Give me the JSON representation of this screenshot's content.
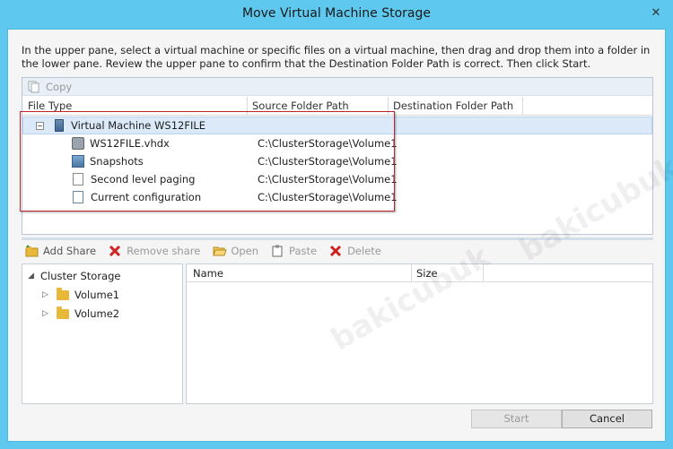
{
  "window": {
    "title": "Move Virtual Machine Storage",
    "close_glyph": "✕"
  },
  "intro_text": "In the upper pane, select a virtual machine or specific files on a virtual machine, then drag and drop them into a folder in the lower pane.  Review the upper pane to confirm that the Destination Folder Path is correct. Then click Start.",
  "upper": {
    "toolbar": {
      "copy_label": "Copy",
      "copy_icon": "copy-icon"
    },
    "columns": [
      "File Type",
      "Source Folder Path",
      "Destination Folder Path"
    ],
    "vm": {
      "expander": "−",
      "label": "Virtual Machine WS12FILE",
      "icon": "vm-icon"
    },
    "rows": [
      {
        "name": "WS12FILE.vhdx",
        "source": "C:\\ClusterStorage\\Volume1",
        "icon": "virtual-disk-icon"
      },
      {
        "name": "Snapshots",
        "source": "C:\\ClusterStorage\\Volume1",
        "icon": "snapshot-icon"
      },
      {
        "name": "Second level paging",
        "source": "C:\\ClusterStorage\\Volume1",
        "icon": "file-icon"
      },
      {
        "name": "Current configuration",
        "source": "C:\\ClusterStorage\\Volume1",
        "icon": "config-file-icon"
      }
    ]
  },
  "lower": {
    "toolbar": {
      "add_share": "Add Share",
      "remove_share": "Remove share",
      "open": "Open",
      "paste": "Paste",
      "delete": "Delete"
    },
    "tree": {
      "root": "Cluster Storage",
      "children": [
        "Volume1",
        "Volume2"
      ]
    },
    "list_columns": [
      "Name",
      "Size"
    ]
  },
  "buttons": {
    "start": "Start",
    "cancel": "Cancel"
  },
  "watermark_text": "bakicubuk",
  "colors": {
    "title_bar": "#5ec8ef",
    "highlight_border": "#c0272d",
    "selection": "#dbe9f9"
  }
}
